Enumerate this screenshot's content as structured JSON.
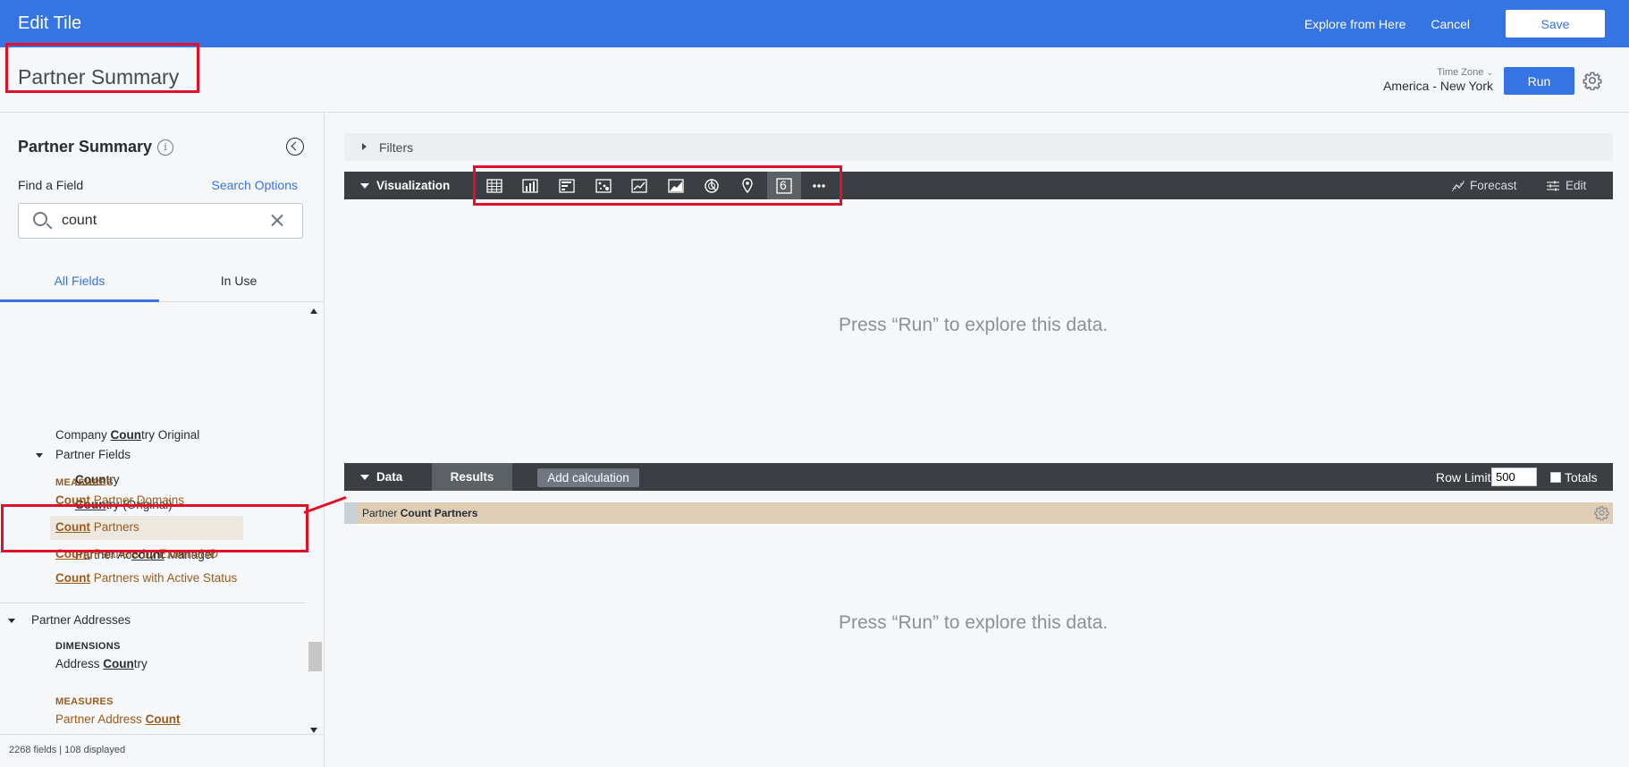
{
  "topbar": {
    "title": "Edit Tile",
    "explore_label": "Explore from Here",
    "cancel_label": "Cancel",
    "save_label": "Save"
  },
  "header": {
    "tile_title": "Partner Summary",
    "timezone_label": "Time Zone",
    "timezone_value": "America - New York",
    "run_label": "Run"
  },
  "left_panel": {
    "title": "Partner Summary",
    "find_label": "Find a Field",
    "search_options_label": "Search Options",
    "search_value": "count",
    "tabs": {
      "all_fields": "All Fields",
      "in_use": "In Use"
    },
    "fields": {
      "company_country_original": {
        "pre": "Company ",
        "match": "Coun",
        "post": "try Original"
      },
      "partner_fields": "Partner Fields",
      "country": {
        "pre": "",
        "match": "Coun",
        "post": "try"
      },
      "country_original": {
        "pre": "",
        "match": "Coun",
        "post": "try (Original)"
      },
      "account_id": {
        "pre": "Ac",
        "match": "count",
        "post": " ID"
      },
      "account_manager": {
        "pre": "Partner Ac",
        "match": "count",
        "post": " Manager"
      },
      "measures_label": "MEASURES",
      "count_partner_domains": {
        "match": "Count",
        "post": " Partner Domains"
      },
      "count_partners": {
        "match": "Count",
        "post": " Partners"
      },
      "count_partners_external": {
        "match": "Count",
        "post": " Partners by External ID"
      },
      "count_partners_active": {
        "match": "Count",
        "post": " Partners with Active Status"
      },
      "partner_addresses": "Partner Addresses",
      "dimensions_label": "DIMENSIONS",
      "address_country": {
        "pre": "Address ",
        "match": "Coun",
        "post": "try"
      },
      "measures_label_2": "MEASURES",
      "partner_address_count": {
        "pre": "Partner Address ",
        "match": "Count"
      }
    },
    "footer": "2268 fields | 108 displayed"
  },
  "main": {
    "filters_label": "Filters",
    "visualization_label": "Visualization",
    "single_value_glyph": "6",
    "forecast_label": "Forecast",
    "edit_label": "Edit",
    "empty_message_viz": "Press “Run” to explore this data.",
    "data_label": "Data",
    "results_label": "Results",
    "add_calculation_label": "Add calculation",
    "row_limit_label": "Row Limit",
    "row_limit_value": "500",
    "totals_label": "Totals",
    "column_header": {
      "view": "Partner",
      "field": "Count Partners"
    },
    "empty_message_data": "Press “Run” to explore this data."
  },
  "colors": {
    "brand_blue": "#3574e3",
    "dark_bar": "#3b3f44",
    "measure_brown": "#9a5b1c",
    "measure_header": "#dfcdb5",
    "annotation_red": "#e0102b"
  }
}
